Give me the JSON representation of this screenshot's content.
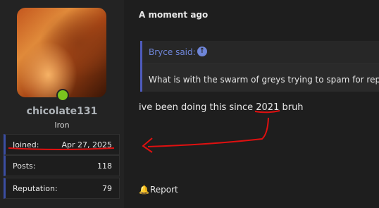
{
  "user": {
    "username": "chicolate131",
    "rank": "Iron",
    "online_color": "#7bc41e",
    "stats": [
      {
        "label": "Joined:",
        "value": "Apr 27, 2025"
      },
      {
        "label": "Posts:",
        "value": "118"
      },
      {
        "label": "Reputation:",
        "value": "79"
      }
    ]
  },
  "post": {
    "timestamp": "A moment ago",
    "quote": {
      "author": "Bryce said:",
      "text": "What is with the swarm of greys trying to spam for reps",
      "jump_icon": "arrow-up-circle-icon"
    },
    "message": "ive been doing this since 2021 bruh",
    "report_label": "Report",
    "report_icon": "bell-icon"
  },
  "colors": {
    "accent": "#4e5bbd",
    "annotation": "#e01010"
  }
}
